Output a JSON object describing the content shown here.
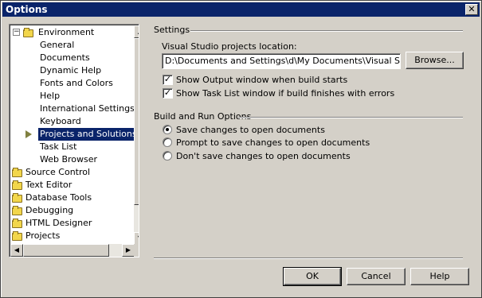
{
  "window": {
    "title": "Options",
    "close_glyph": "✕"
  },
  "tree": {
    "items": [
      {
        "label": "Environment",
        "expander": "−"
      },
      {
        "label": "General"
      },
      {
        "label": "Documents"
      },
      {
        "label": "Dynamic Help"
      },
      {
        "label": "Fonts and Colors"
      },
      {
        "label": "Help"
      },
      {
        "label": "International Settings"
      },
      {
        "label": "Keyboard"
      },
      {
        "label": "Projects and Solutions"
      },
      {
        "label": "Task List"
      },
      {
        "label": "Web Browser"
      },
      {
        "label": "Source Control"
      },
      {
        "label": "Text Editor"
      },
      {
        "label": "Database Tools"
      },
      {
        "label": "Debugging"
      },
      {
        "label": "HTML Designer"
      },
      {
        "label": "Projects"
      }
    ],
    "selected": "Projects and Solutions"
  },
  "settings": {
    "group_title": "Settings",
    "location_label": "Visual Studio projects location:",
    "location_value": "D:\\Documents and Settings\\d\\My Documents\\Visual Studio Projects",
    "browse_label": "Browse...",
    "show_output_label": "Show Output window when build starts",
    "show_output_checked": true,
    "show_tasklist_label": "Show Task List window if build finishes with errors",
    "show_tasklist_checked": true
  },
  "build_run": {
    "group_title": "Build and Run Options",
    "options": [
      {
        "label": "Save changes to open documents",
        "selected": true
      },
      {
        "label": "Prompt to save changes to open documents",
        "selected": false
      },
      {
        "label": "Don't save changes to open documents",
        "selected": false
      }
    ]
  },
  "buttons": {
    "ok": "OK",
    "cancel": "Cancel",
    "help": "Help"
  },
  "scroll_glyphs": {
    "up": "▲",
    "down": "▼",
    "left": "◀",
    "right": "▶"
  },
  "check_glyph": "✓"
}
